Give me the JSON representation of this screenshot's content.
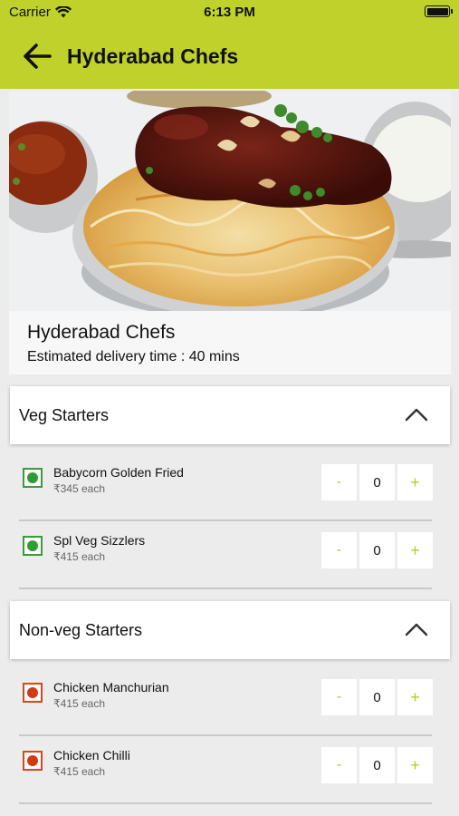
{
  "status_bar": {
    "carrier": "Carrier",
    "time": "6:13 PM"
  },
  "header": {
    "title": "Hyderabad Chefs",
    "back_icon": "arrow-left-icon",
    "bar_color": "#c0d12c"
  },
  "hero": {
    "image_subject": "biryani-plate"
  },
  "restaurant": {
    "name": "Hyderabad Chefs",
    "eta": "Estimated delivery time : 40 mins"
  },
  "sections": [
    {
      "title": "Veg Starters",
      "expanded": true,
      "items": [
        {
          "name": "Babycorn Golden Fried",
          "price": "₹345 each",
          "type": "veg",
          "minus": "-",
          "qty": "0",
          "plus": "+"
        },
        {
          "name": "Spl Veg Sizzlers",
          "price": "₹415 each",
          "type": "veg",
          "minus": "-",
          "qty": "0",
          "plus": "+"
        }
      ]
    },
    {
      "title": "Non-veg Starters",
      "expanded": true,
      "items": [
        {
          "name": "Chicken Manchurian",
          "price": "₹415 each",
          "type": "non-veg",
          "minus": "-",
          "qty": "0",
          "plus": "+"
        },
        {
          "name": "Chicken Chilli",
          "price": "₹415 each",
          "type": "non-veg",
          "minus": "-",
          "qty": "0",
          "plus": "+"
        }
      ]
    }
  ],
  "colors": {
    "accent": "#c0d12c",
    "veg": "#2e9c2e",
    "non_veg": "#d33a14"
  }
}
